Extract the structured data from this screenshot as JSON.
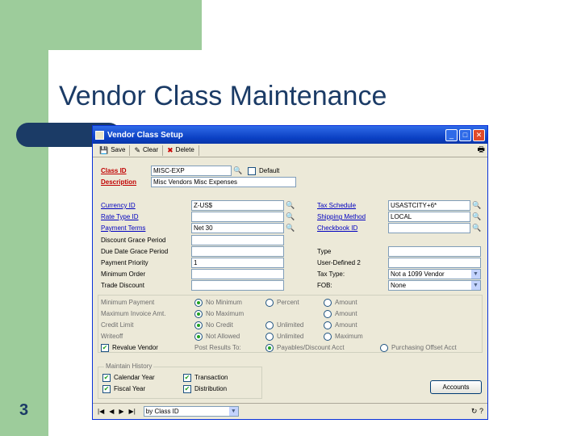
{
  "slide": {
    "title": "Vendor Class Maintenance",
    "number": "3"
  },
  "window": {
    "title": "Vendor Class Setup",
    "controls": {
      "minimize": "_",
      "maximize": "□",
      "close": "✕"
    }
  },
  "toolbar": {
    "save_label": "Save",
    "clear_label": "Clear",
    "delete_label": "Delete"
  },
  "header": {
    "class_id_label": "Class ID",
    "class_id_value": "MISC-EXP",
    "default_label": "Default",
    "default_checked": false,
    "description_label": "Description",
    "description_value": "Misc Vendors Misc Expenses"
  },
  "left": {
    "currency_id_label": "Currency ID",
    "currency_id_value": "Z-US$",
    "rate_type_id_label": "Rate Type ID",
    "rate_type_id_value": "",
    "payment_terms_label": "Payment Terms",
    "payment_terms_value": "Net 30",
    "discount_grace_label": "Discount Grace Period",
    "discount_grace_value": "",
    "due_date_grace_label": "Due Date Grace Period",
    "due_date_grace_value": "",
    "payment_priority_label": "Payment Priority",
    "payment_priority_value": "1",
    "minimum_order_label": "Minimum Order",
    "minimum_order_value": "",
    "trade_discount_label": "Trade Discount",
    "trade_discount_value": ""
  },
  "right": {
    "tax_schedule_label": "Tax Schedule",
    "tax_schedule_value": "USASTCITY+6*",
    "shipping_method_label": "Shipping Method",
    "shipping_method_value": "LOCAL",
    "checkbook_id_label": "Checkbook ID",
    "checkbook_id_value": "",
    "type_label": "Type",
    "type_value": "",
    "user_defined_label": "User-Defined 2",
    "user_defined_value": "",
    "tax_type_label": "Tax Type:",
    "tax_type_value": "Not a 1099 Vendor",
    "fob_label": "FOB:",
    "fob_value": "None"
  },
  "limits": {
    "minimum_payment_label": "Minimum Payment",
    "minimum_payment_options": [
      "No Minimum",
      "Percent",
      "Amount"
    ],
    "maximum_invoice_label": "Maximum Invoice Amt.",
    "maximum_invoice_options": [
      "No Maximum",
      "Amount"
    ],
    "credit_limit_label": "Credit Limit",
    "credit_limit_options": [
      "No Credit",
      "Unlimited",
      "Amount"
    ],
    "writeoff_label": "Writeoff",
    "writeoff_options": [
      "Not Allowed",
      "Unlimited",
      "Maximum"
    ],
    "revalue_vendor_label": "Revalue Vendor",
    "post_results_label": "Post Results To:",
    "post_results_options": [
      "Payables/Discount Acct",
      "Purchasing Offset Acct"
    ]
  },
  "history": {
    "title": "Maintain History",
    "calendar_year": "Calendar Year",
    "fiscal_year": "Fiscal Year",
    "transaction": "Transaction",
    "distribution": "Distribution"
  },
  "accounts_button": "Accounts",
  "statusbar": {
    "sort_value": "by Class ID",
    "nav_first": "|◀",
    "nav_prev": "◀",
    "nav_next": "▶",
    "nav_last": "▶|"
  }
}
